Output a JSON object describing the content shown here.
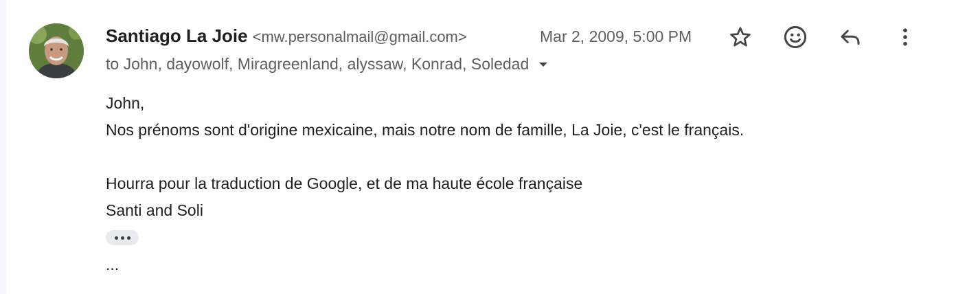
{
  "message": {
    "sender_name": "Santiago La Joie",
    "sender_email": "<mw.personalmail@gmail.com>",
    "date": "Mar 2, 2009, 5:00 PM",
    "recipients": "to John, dayowolf, Miragreenland, alyssaw, Konrad, Soledad",
    "body_lines": [
      "John,",
      "Nos prénoms sont d'origine mexicaine, mais notre nom de famille, La Joie, c'est le français.",
      "",
      "Hourra pour la traduction de Google, et de ma haute école française",
      "Santi and Soli"
    ],
    "trailing_text": "..."
  },
  "icons": {
    "star": "star-icon",
    "emoji": "smiley-icon",
    "reply": "reply-icon",
    "more": "more-vertical-icon",
    "caret": "caret-down-icon",
    "show_trimmed": "show-trimmed-content-icon"
  },
  "colors": {
    "text_primary": "#1f1f1f",
    "text_secondary": "#5e5e5e",
    "icon": "#444746",
    "chip": "#e8eaed"
  }
}
